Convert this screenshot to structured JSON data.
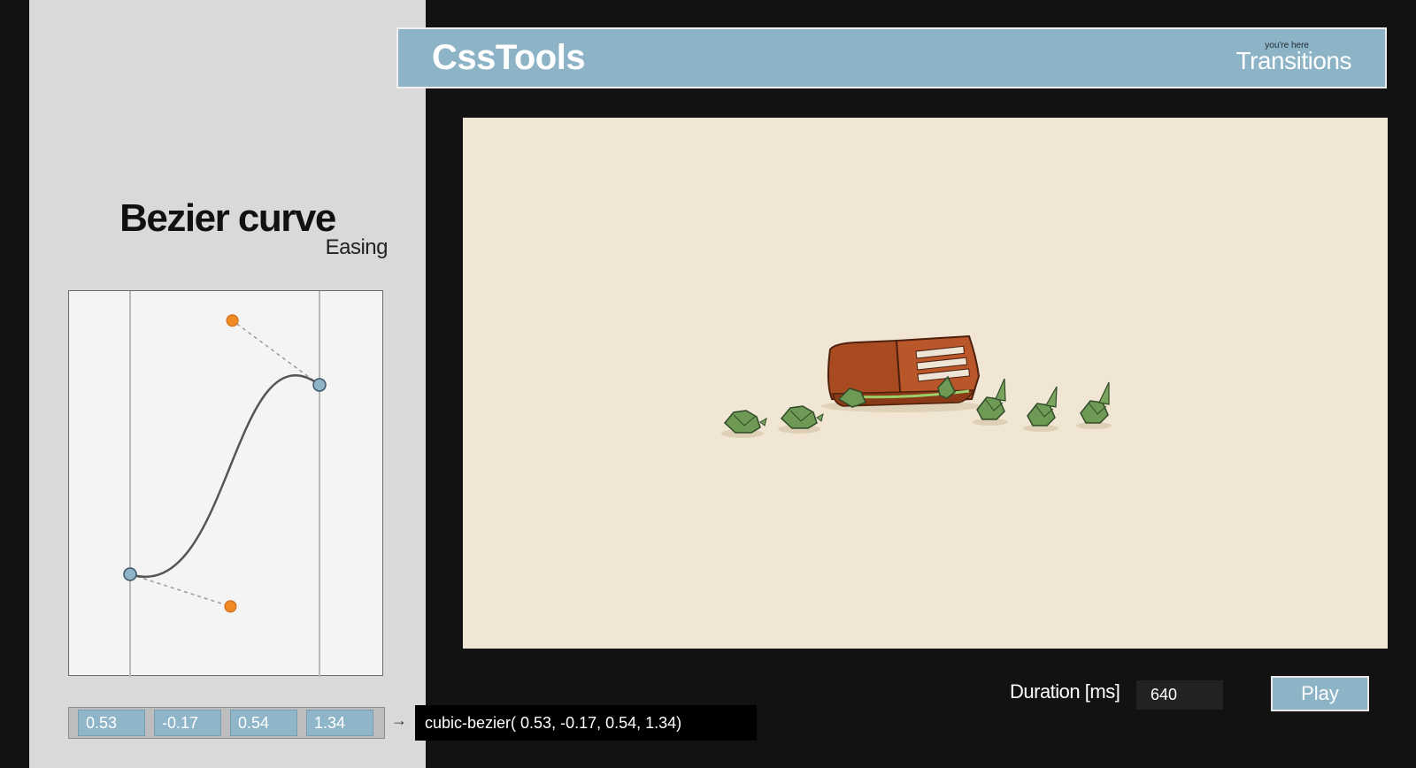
{
  "header": {
    "brand": "CssTools",
    "here_label": "you're here",
    "page_label": "Transitions"
  },
  "sidebar": {
    "title": "Bezier curve",
    "subtitle": "Easing",
    "bezier": [
      0.53,
      -0.17,
      0.54,
      1.34
    ],
    "inputs": [
      "0.53",
      "-0.17",
      "0.54",
      "1.34"
    ],
    "arrow": "→",
    "output": "cubic-bezier( 0.53, -0.17, 0.54, 1.34)"
  },
  "controls": {
    "duration_label": "Duration [ms]",
    "duration_value": "640",
    "play_label": "Play"
  },
  "colors": {
    "accent": "#8db3c6",
    "handle": "#f08a24",
    "endpoint": "#8fb3c7",
    "stage": "#f1e6d4"
  }
}
